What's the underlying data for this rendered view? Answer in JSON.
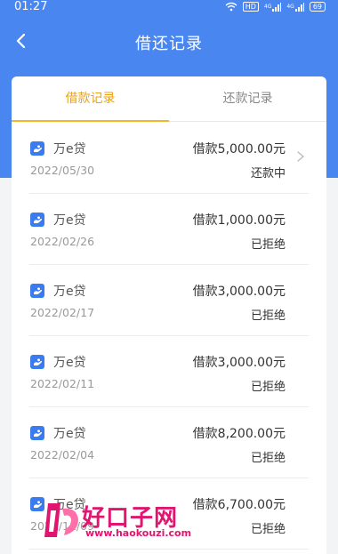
{
  "status_bar": {
    "time": "01:27",
    "hd_label": "HD",
    "signal_1": "4G",
    "signal_2": "4G",
    "battery": "69"
  },
  "navbar": {
    "title": "借还记录"
  },
  "tabs": [
    {
      "label": "借款记录",
      "active": true
    },
    {
      "label": "还款记录",
      "active": false
    }
  ],
  "records": [
    {
      "name": "万e贷",
      "date": "2022/05/30",
      "amount": "借款5,000.00元",
      "status": "还款中",
      "has_chevron": true
    },
    {
      "name": "万e贷",
      "date": "2022/02/26",
      "amount": "借款1,000.00元",
      "status": "已拒绝",
      "has_chevron": false
    },
    {
      "name": "万e贷",
      "date": "2022/02/17",
      "amount": "借款3,000.00元",
      "status": "已拒绝",
      "has_chevron": false
    },
    {
      "name": "万e贷",
      "date": "2022/02/11",
      "amount": "借款3,000.00元",
      "status": "已拒绝",
      "has_chevron": false
    },
    {
      "name": "万e贷",
      "date": "2022/02/04",
      "amount": "借款8,200.00元",
      "status": "已拒绝",
      "has_chevron": false
    },
    {
      "name": "万e贷",
      "date": "2021/11/09",
      "amount": "借款6,700.00元",
      "status": "已拒绝",
      "has_chevron": false
    }
  ],
  "watermark": {
    "title": "好口子网",
    "url": "www.haokouzi.com"
  },
  "colors": {
    "brand_blue": "#4a86f0",
    "tab_active": "#e8a21a",
    "watermark": "#e0156f"
  }
}
